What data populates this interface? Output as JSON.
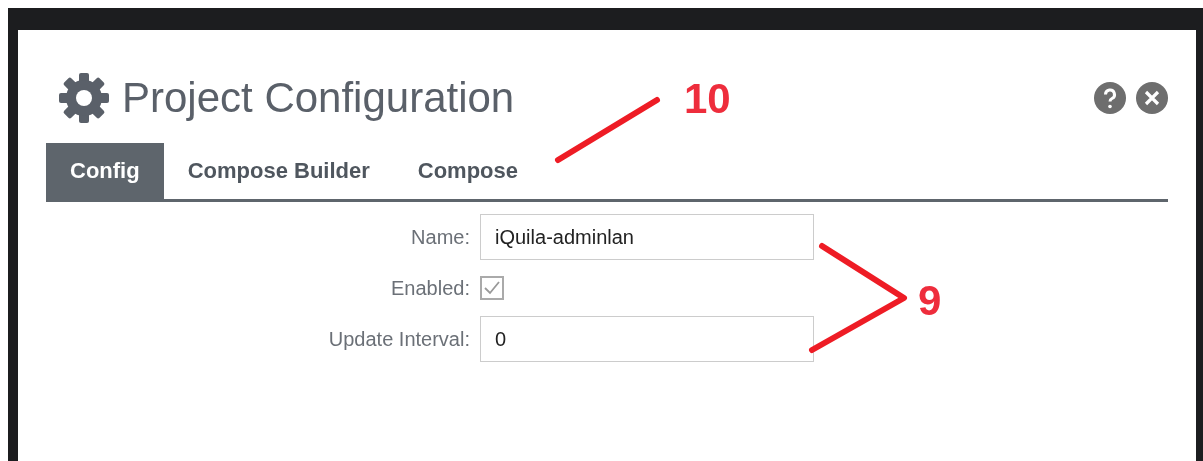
{
  "dialog": {
    "title": "Project Configuration"
  },
  "tabs": [
    {
      "label": "Config",
      "selected": true
    },
    {
      "label": "Compose Builder",
      "selected": false
    },
    {
      "label": "Compose",
      "selected": false
    }
  ],
  "fields": [
    {
      "kind": "text",
      "label": "Name:",
      "value": "iQuila-adminlan"
    },
    {
      "kind": "checkbox",
      "label": "Enabled:",
      "checked": true,
      "disabled": true
    },
    {
      "kind": "text",
      "label": "Update Interval:",
      "value": "0"
    }
  ],
  "annotations": [
    {
      "label": "10",
      "kind": "line"
    },
    {
      "label": "9",
      "kind": "bracket"
    }
  ]
}
